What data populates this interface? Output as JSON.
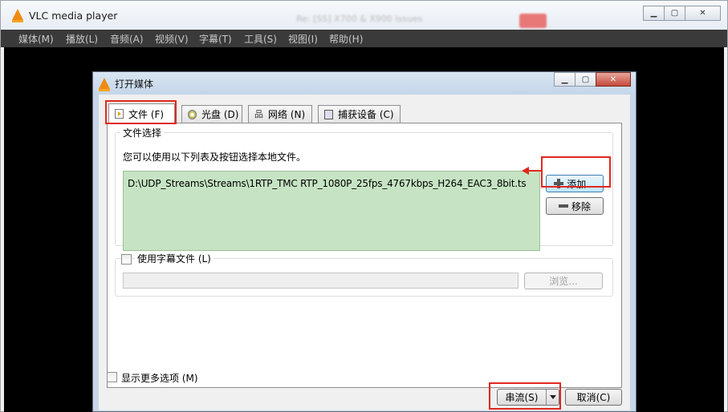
{
  "app": {
    "title": "VLC media player",
    "background_tab_text": "Re: [SS] X700 & X900 Issues"
  },
  "menu": {
    "items": [
      "媒体(M)",
      "播放(L)",
      "音频(A)",
      "视频(V)",
      "字幕(T)",
      "工具(S)",
      "视图(I)",
      "帮助(H)"
    ]
  },
  "dialog": {
    "title": "打开媒体",
    "tabs": [
      {
        "label": "文件 (F)",
        "icon": "file-icon"
      },
      {
        "label": "光盘 (D)",
        "icon": "disc-icon"
      },
      {
        "label": "网络 (N)",
        "icon": "network-icon"
      },
      {
        "label": "捕获设备 (C)",
        "icon": "capture-device-icon"
      }
    ],
    "file_selection": {
      "legend": "文件选择",
      "hint": "您可以使用以下列表及按钮选择本地文件。",
      "files": [
        "D:\\UDP_Streams\\Streams\\1RTP_TMC RTP_1080P_25fps_4767kbps_H264_EAC3_8bit.ts"
      ],
      "add_label": "添加...",
      "remove_label": "移除"
    },
    "subtitle": {
      "checkbox_label": "使用字幕文件 (L)",
      "path_value": "",
      "browse_label": "浏览..."
    },
    "more_options_label": "显示更多选项 (M)",
    "stream_label": "串流(S)",
    "cancel_label": "取消(C)"
  },
  "colors": {
    "annotation_red": "#e0281f",
    "file_list_bg": "#c6e4c3",
    "menubar_bg": "#3a3a3a"
  }
}
